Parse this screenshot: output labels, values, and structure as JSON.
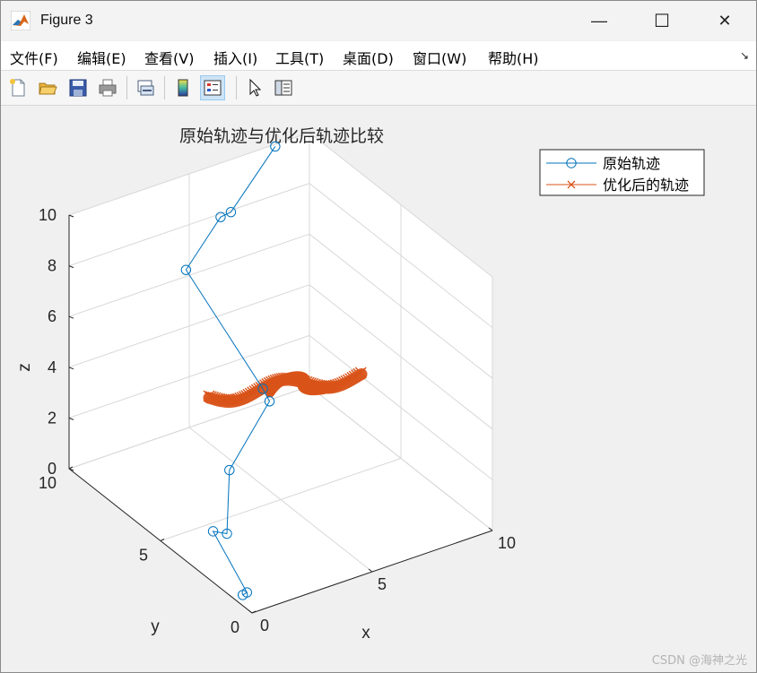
{
  "window": {
    "title": "Figure 3",
    "controls": {
      "minimize": "—",
      "maximize": "☐",
      "close": "✕"
    }
  },
  "menu": {
    "items": [
      "文件(F)",
      "编辑(E)",
      "查看(V)",
      "插入(I)",
      "工具(T)",
      "桌面(D)",
      "窗口(W)",
      "帮助(H)"
    ],
    "dock_arrow": "↘"
  },
  "toolbar": {
    "buttons": [
      {
        "icon": "new-figure-icon"
      },
      {
        "icon": "open-file-icon"
      },
      {
        "icon": "save-icon"
      },
      {
        "icon": "print-icon"
      },
      {
        "icon": "link-plot-icon"
      },
      {
        "icon": "colorbar-icon"
      },
      {
        "icon": "legend-icon",
        "active": true
      },
      {
        "icon": "pointer-icon"
      },
      {
        "icon": "property-inspector-icon"
      }
    ]
  },
  "chart_data": {
    "type": "line3d",
    "title": "原始轨迹与优化后轨迹比较",
    "xlabel": "x",
    "ylabel": "y",
    "zlabel": "z",
    "xlim": [
      0,
      10
    ],
    "ylim": [
      0,
      10
    ],
    "zlim": [
      0,
      10
    ],
    "xticks": [
      "0",
      "5",
      "10"
    ],
    "yticks": [
      "0",
      "5",
      "10"
    ],
    "zticks": [
      "0",
      "2",
      "4",
      "6",
      "8",
      "10"
    ],
    "grid": true,
    "legend_position": "top-right",
    "series": [
      {
        "name": "原始轨迹",
        "color": "#0072BD",
        "marker": "o",
        "points": [
          [
            0.3,
            0.9,
            0.1
          ],
          [
            0.7,
            1.2,
            -0.1
          ],
          [
            1.5,
            4.1,
            0.4
          ],
          [
            2.0,
            4.0,
            0.2
          ],
          [
            1.8,
            3.6,
            3.0
          ],
          [
            4.0,
            4.3,
            4.6
          ],
          [
            3.8,
            4.4,
            5.1
          ],
          [
            3.8,
            8.6,
            7.4
          ],
          [
            6.0,
            9.6,
            8.2
          ],
          [
            6.2,
            9.3,
            8.5
          ],
          [
            8.5,
            9.9,
            10.0
          ]
        ]
      },
      {
        "name": "优化后的轨迹",
        "color": "#D95319",
        "marker": "x"
      }
    ],
    "watermark": "CSDN @海神之光"
  }
}
